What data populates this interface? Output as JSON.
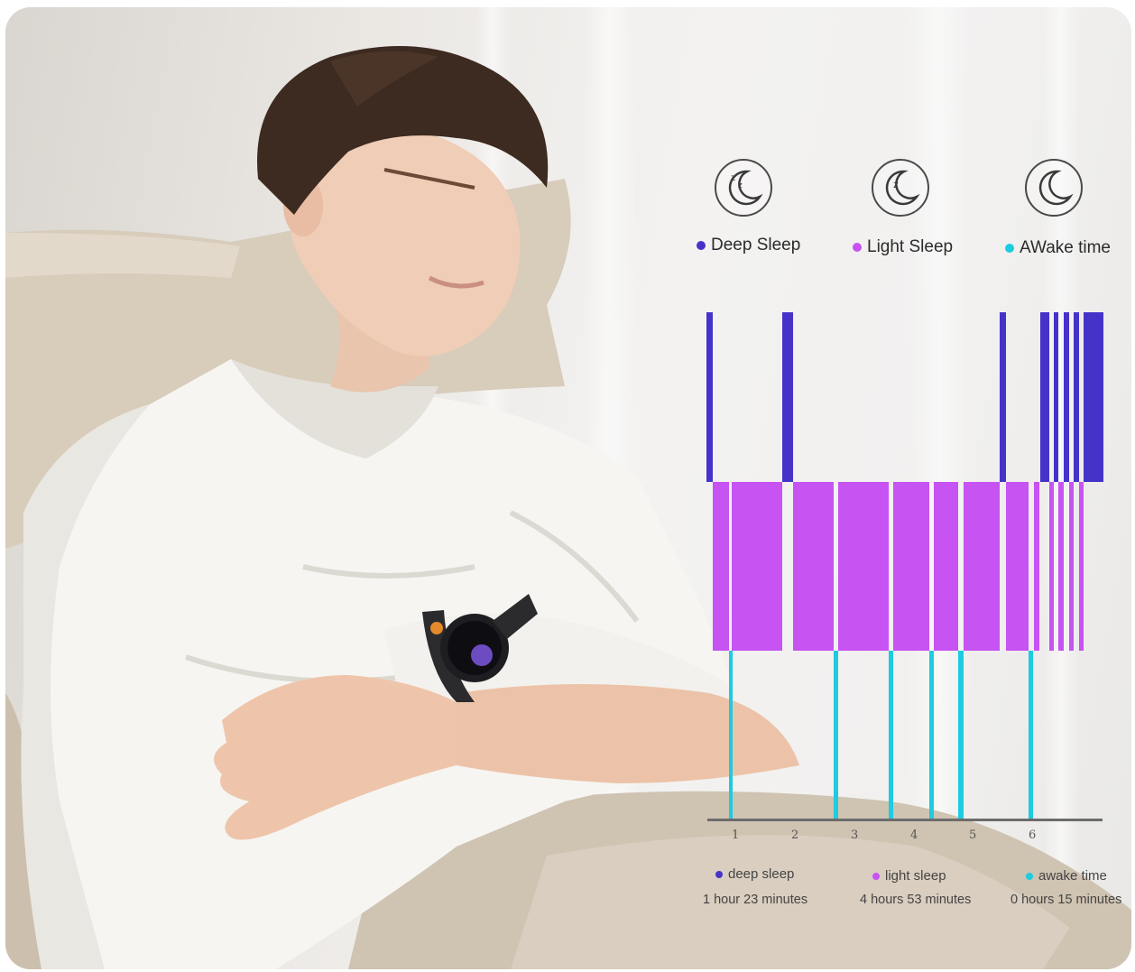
{
  "legend": {
    "deep": "Deep Sleep",
    "light": "Light Sleep",
    "awake": "AWake time"
  },
  "icons": [
    "moon-zzz-icon",
    "moon-z-icon",
    "moon-icon"
  ],
  "colors": {
    "deep": "#4533c9",
    "light": "#c653f2",
    "awake": "#1ecbe0"
  },
  "chart_data": {
    "type": "bar",
    "ticks": [
      "1",
      "2",
      "3",
      "4",
      "5",
      "6"
    ],
    "series": [
      {
        "name": "Deep Sleep",
        "level": "top"
      },
      {
        "name": "Light Sleep",
        "level": "middle"
      },
      {
        "name": "AWake time",
        "level": "bottom"
      }
    ]
  },
  "summary": {
    "deep_label": "deep sleep",
    "deep_value": "1 hour 23 minutes",
    "light_label": "light sleep",
    "light_value": "4 hours 53 minutes",
    "awake_label": "awake time",
    "awake_value": "0 hours 15 minutes"
  }
}
